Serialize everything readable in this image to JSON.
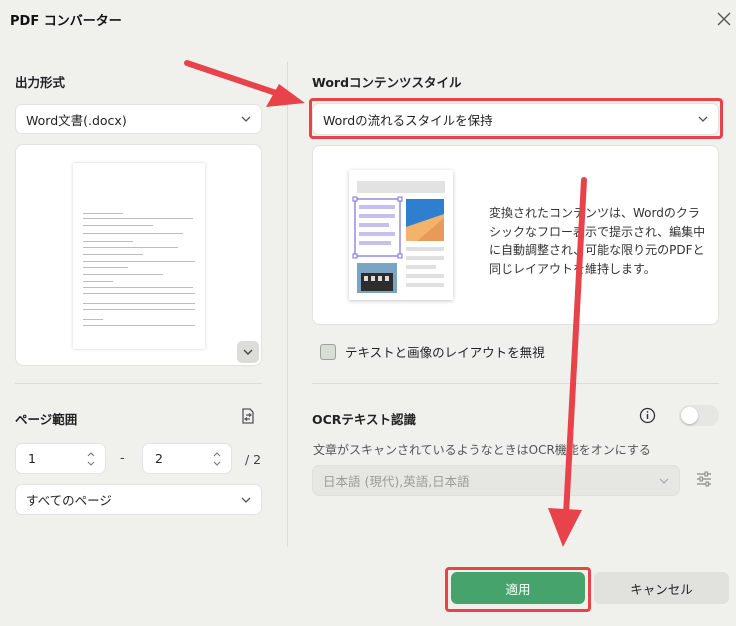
{
  "window": {
    "title": "PDF コンバーター"
  },
  "output": {
    "label": "出力形式",
    "format_value": "Word文書(.docx)"
  },
  "page_range": {
    "label": "ページ範囲",
    "from": "1",
    "separator": "-",
    "to": "2",
    "total": "/ 2",
    "scope_value": "すべてのページ"
  },
  "word_style": {
    "label": "Wordコンテンツスタイル",
    "selected": "Wordの流れるスタイルを保持",
    "description": "変換されたコンテンツは、Wordのクラシックなフロー表示で提示され、編集中に自動調整され、可能な限り元のPDFと同じレイアウトを維持します。",
    "ignore_layout_label": "テキストと画像のレイアウトを無視"
  },
  "ocr": {
    "label": "OCRテキスト認識",
    "hint": "文章がスキャンされているようなときはOCR機能をオンにする",
    "language_value": "日本語 (現代),英語,日本語",
    "enabled": false
  },
  "buttons": {
    "apply": "適用",
    "cancel": "キャンセル"
  },
  "colors": {
    "accent_green": "#46a36b",
    "annotation_red": "#e8434b",
    "background": "#f0f1ed"
  }
}
